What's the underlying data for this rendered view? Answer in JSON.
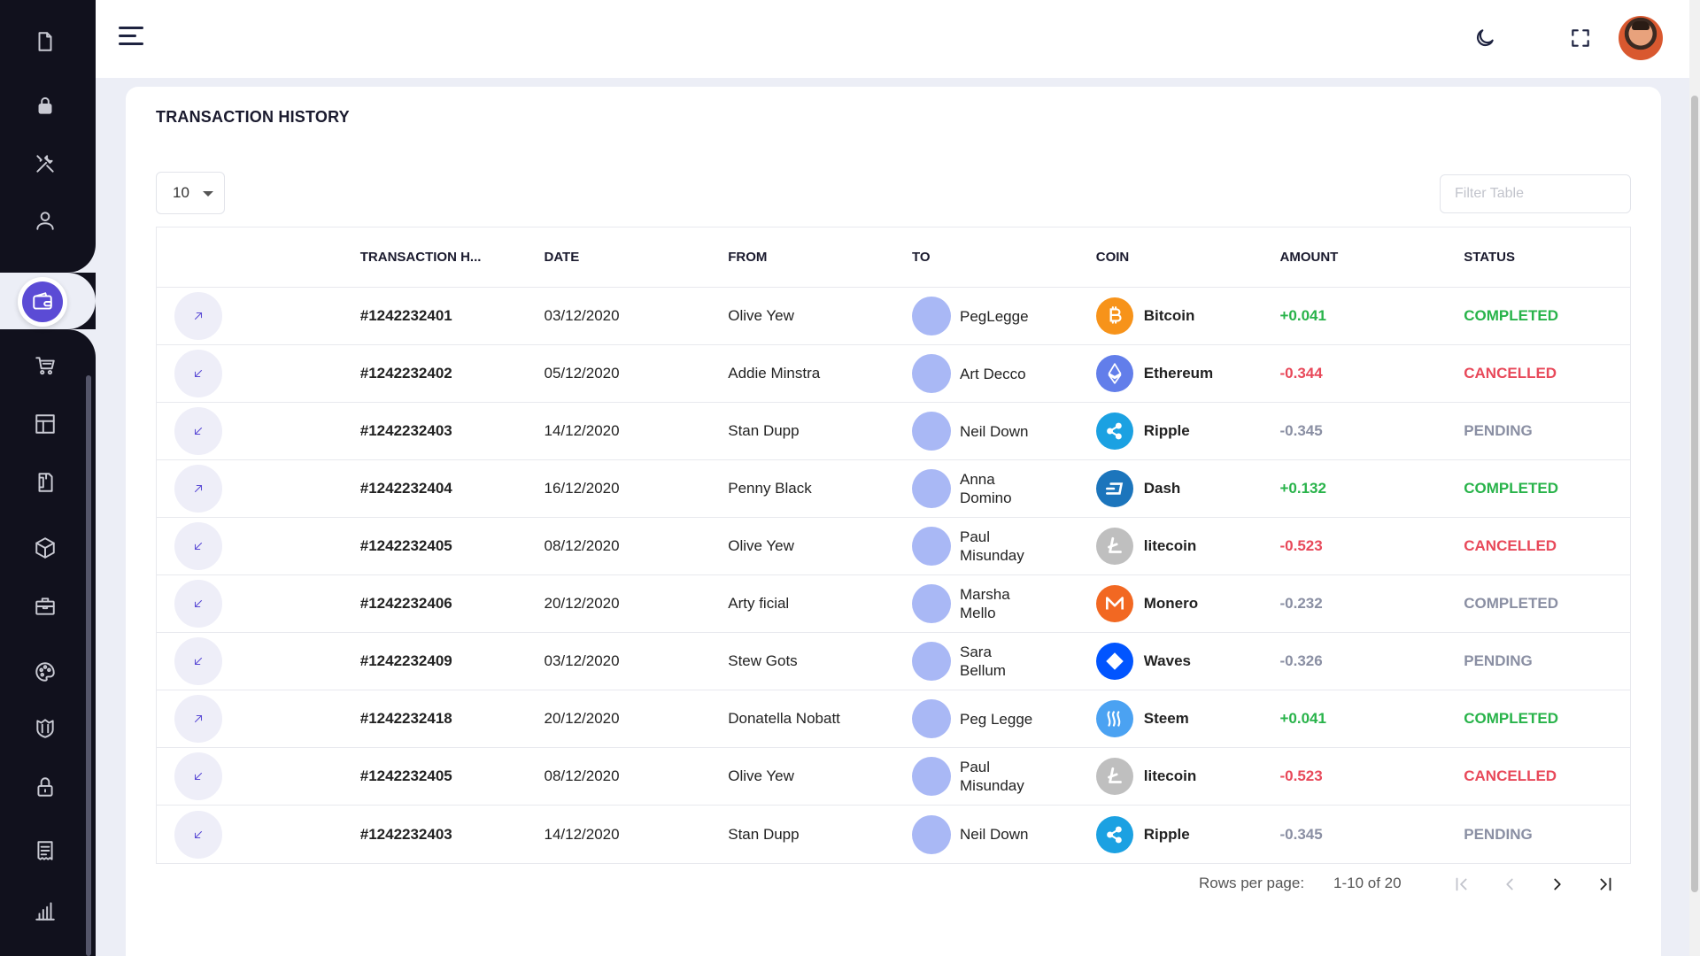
{
  "sidebar": {
    "items": [
      {
        "icon": "document-icon"
      },
      {
        "icon": "lock-icon"
      },
      {
        "icon": "tools-icon"
      },
      {
        "icon": "user-icon"
      },
      {
        "icon": "wallet-icon",
        "active": true
      },
      {
        "icon": "cart-icon"
      },
      {
        "icon": "layout-icon"
      },
      {
        "icon": "book-icon"
      },
      {
        "icon": "box-icon"
      },
      {
        "icon": "briefcase-icon"
      },
      {
        "icon": "palette-icon"
      },
      {
        "icon": "shield-icon"
      },
      {
        "icon": "padlock-icon"
      },
      {
        "icon": "receipt-icon"
      },
      {
        "icon": "chart-icon"
      }
    ]
  },
  "topbar": {
    "icons": [
      "menu-icon",
      "moon-icon",
      "fullscreen-icon",
      "avatar"
    ]
  },
  "card": {
    "title": "TRANSACTION HISTORY",
    "rows_select": "10",
    "filter_placeholder": "Filter Table"
  },
  "table": {
    "headers": [
      "",
      "TRANSACTION H...",
      "DATE",
      "FROM",
      "TO",
      "COIN",
      "AMOUNT",
      "STATUS"
    ],
    "rows": [
      {
        "dir": "out",
        "hash": "#1242232401",
        "date": "03/12/2020",
        "from": "Olive Yew",
        "to": "PegLegge",
        "coin": "Bitcoin",
        "amount": "+0.041",
        "amount_kind": "pos",
        "status": "COMPLETED",
        "status_kind": "completed"
      },
      {
        "dir": "in",
        "hash": "#1242232402",
        "date": "05/12/2020",
        "from": "Addie Minstra",
        "to": "Art Decco",
        "coin": "Ethereum",
        "amount": "-0.344",
        "amount_kind": "neg",
        "status": "CANCELLED",
        "status_kind": "cancelled"
      },
      {
        "dir": "in",
        "hash": "#1242232403",
        "date": "14/12/2020",
        "from": "Stan Dupp",
        "to": "Neil Down",
        "coin": "Ripple",
        "amount": "-0.345",
        "amount_kind": "neu",
        "status": "PENDING",
        "status_kind": "pending"
      },
      {
        "dir": "out",
        "hash": "#1242232404",
        "date": "16/12/2020",
        "from": "Penny Black",
        "to": "Anna Domino",
        "coin": "Dash",
        "amount": "+0.132",
        "amount_kind": "pos",
        "status": "COMPLETED",
        "status_kind": "completed"
      },
      {
        "dir": "in",
        "hash": "#1242232405",
        "date": "08/12/2020",
        "from": "Olive Yew",
        "to": "Paul Misunday",
        "coin": "litecoin",
        "amount": "-0.523",
        "amount_kind": "neg",
        "status": "CANCELLED",
        "status_kind": "cancelled"
      },
      {
        "dir": "in",
        "hash": "#1242232406",
        "date": "20/12/2020",
        "from": "Arty ficial",
        "to": "Marsha Mello",
        "coin": "Monero",
        "amount": "-0.232",
        "amount_kind": "neu",
        "status": "COMPLETED",
        "status_kind": "completed-muted"
      },
      {
        "dir": "in",
        "hash": "#1242232409",
        "date": "03/12/2020",
        "from": "Stew Gots",
        "to": "Sara Bellum",
        "coin": "Waves",
        "amount": "-0.326",
        "amount_kind": "neu",
        "status": "PENDING",
        "status_kind": "pending"
      },
      {
        "dir": "out",
        "hash": "#1242232418",
        "date": "20/12/2020",
        "from": "Donatella Nobatt",
        "to": "Peg Legge",
        "coin": "Steem",
        "amount": "+0.041",
        "amount_kind": "pos",
        "status": "COMPLETED",
        "status_kind": "completed"
      },
      {
        "dir": "in",
        "hash": "#1242232405",
        "date": "08/12/2020",
        "from": "Olive Yew",
        "to": "Paul Misunday",
        "coin": "litecoin",
        "amount": "-0.523",
        "amount_kind": "neg",
        "status": "CANCELLED",
        "status_kind": "cancelled"
      },
      {
        "dir": "in",
        "hash": "#1242232403",
        "date": "14/12/2020",
        "from": "Stan Dupp",
        "to": "Neil Down",
        "coin": "Ripple",
        "amount": "-0.345",
        "amount_kind": "neu",
        "status": "PENDING",
        "status_kind": "pending"
      }
    ]
  },
  "coins": {
    "Bitcoin": {
      "color": "#f7931a",
      "icon": "bitcoin-icon"
    },
    "Ethereum": {
      "color": "#627eea",
      "icon": "ethereum-icon"
    },
    "Ripple": {
      "color": "#1ba1e2",
      "icon": "ripple-icon"
    },
    "Dash": {
      "color": "#1c75bc",
      "icon": "dash-icon"
    },
    "litecoin": {
      "color": "#bfbfbf",
      "icon": "litecoin-icon"
    },
    "Monero": {
      "color": "#f26822",
      "icon": "monero-icon"
    },
    "Waves": {
      "color": "#0155ff",
      "icon": "waves-icon"
    },
    "Steem": {
      "color": "#4ba2f2",
      "icon": "steem-icon"
    }
  },
  "pagination": {
    "rows_per_page_label": "Rows per page:",
    "range": "1-10 of 20"
  },
  "colors": {
    "accent": "#5b4bd5",
    "sidebar_bg": "#11111d",
    "positive": "#28b34a",
    "negative": "#e8495a",
    "neutral": "#8a8fa3"
  }
}
